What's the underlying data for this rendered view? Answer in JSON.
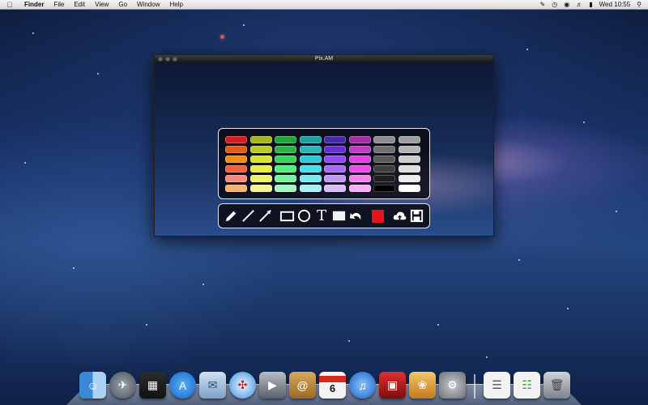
{
  "menubar": {
    "apple_icon": "apple-icon",
    "app_name": "Finder",
    "menus": [
      "File",
      "Edit",
      "View",
      "Go",
      "Window",
      "Help"
    ],
    "clock": "Wed 10:55"
  },
  "window": {
    "title": "Pix.AM"
  },
  "palette": {
    "colors": [
      [
        "#d61c22",
        "#a7b51a",
        "#21a43a",
        "#1ea19c",
        "#4b2aa8",
        "#a72da5",
        "#8e8e8e",
        "#9e9e9e"
      ],
      [
        "#e35a13",
        "#bcc926",
        "#2ab443",
        "#26b6b9",
        "#6a2ed0",
        "#c13ac6",
        "#6f6f6f",
        "#b5b5b5"
      ],
      [
        "#ef8d14",
        "#d8e42c",
        "#37d35d",
        "#2ccad9",
        "#8e4cef",
        "#e043df",
        "#595959",
        "#cdcdcd"
      ],
      [
        "#f1603c",
        "#e9ee45",
        "#4ff07d",
        "#47dfee",
        "#a86bf4",
        "#f04ce8",
        "#3f3f3f",
        "#dedede"
      ],
      [
        "#f58a78",
        "#f2f06e",
        "#73f49c",
        "#79e9f3",
        "#c29af6",
        "#f583ee",
        "#1f1f1f",
        "#ececec"
      ],
      [
        "#f7b36d",
        "#f5f48f",
        "#a2f6bc",
        "#a8f0f6",
        "#d9bff8",
        "#f8b0f3",
        "#000000",
        "#ffffff"
      ]
    ]
  },
  "toolbar": {
    "tools": [
      "pen-tool",
      "line-tool",
      "arrow-tool",
      "rectangle-tool",
      "ellipse-tool",
      "text-tool",
      "highlight-tool",
      "undo-tool",
      "cloud-upload-tool",
      "save-tool"
    ],
    "text_tool_label": "T",
    "selected_color": "#e6141c"
  },
  "dock": {
    "items": [
      "finder-icon",
      "launchpad-icon",
      "mission-control-icon",
      "app-store-icon",
      "mail-icon",
      "safari-icon",
      "facetime-icon",
      "address-book-icon",
      "calendar-icon",
      "itunes-icon",
      "photo-booth-icon",
      "iphoto-icon",
      "system-preferences-icon",
      "document-icon",
      "document-icon",
      "trash-icon"
    ],
    "calendar_day": "6"
  }
}
